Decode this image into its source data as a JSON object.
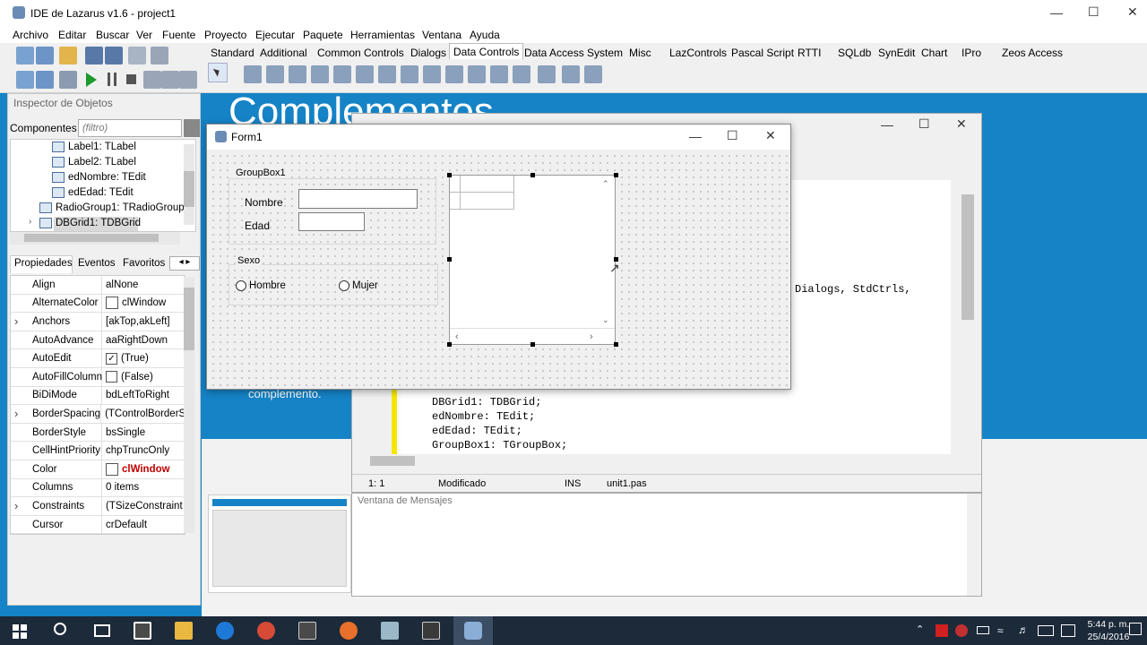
{
  "ide": {
    "title": "IDE de Lazarus v1.6 - project1",
    "menu": [
      "Archivo",
      "Editar",
      "Buscar",
      "Ver",
      "Fuente",
      "Proyecto",
      "Ejecutar",
      "Paquete",
      "Herramientas",
      "Ventana",
      "Ayuda"
    ],
    "palette_tabs": [
      "Standard",
      "Additional",
      "Common Controls",
      "Dialogs",
      "Data Controls",
      "Data Access",
      "System",
      "Misc",
      "LazControls",
      "Pascal Script",
      "RTTI",
      "SQLdb",
      "SynEdit",
      "Chart",
      "IPro",
      "Zeos Access"
    ],
    "active_tab": "Data Controls"
  },
  "desktop": {
    "title": "Complementos",
    "caption": "complemento."
  },
  "inspector": {
    "title": "Inspector de Objetos",
    "components_label": "Componentes",
    "filter_placeholder": "(filtro)",
    "tree": [
      "Label1: TLabel",
      "Label2: TLabel",
      "edNombre: TEdit",
      "edEdad: TEdit",
      "RadioGroup1: TRadioGroup",
      "DBGrid1: TDBGrid"
    ],
    "tabs": [
      "Propiedades",
      "Eventos",
      "Favoritos"
    ],
    "props": [
      {
        "name": "Align",
        "value": "alNone",
        "expand": false,
        "kind": "text"
      },
      {
        "name": "AlternateColor",
        "value": "clWindow",
        "expand": false,
        "kind": "color"
      },
      {
        "name": "Anchors",
        "value": "[akTop,akLeft]",
        "expand": true,
        "kind": "text"
      },
      {
        "name": "AutoAdvance",
        "value": "aaRightDown",
        "expand": false,
        "kind": "text"
      },
      {
        "name": "AutoEdit",
        "value": "(True)",
        "expand": false,
        "kind": "check-on"
      },
      {
        "name": "AutoFillColumn",
        "value": "(False)",
        "expand": false,
        "kind": "check-off"
      },
      {
        "name": "BiDiMode",
        "value": "bdLeftToRight",
        "expand": false,
        "kind": "text"
      },
      {
        "name": "BorderSpacing",
        "value": "(TControlBorderS",
        "expand": true,
        "kind": "text"
      },
      {
        "name": "BorderStyle",
        "value": "bsSingle",
        "expand": false,
        "kind": "text"
      },
      {
        "name": "CellHintPriority",
        "value": "chpTruncOnly",
        "expand": false,
        "kind": "text"
      },
      {
        "name": "Color",
        "value": "clWindow",
        "expand": false,
        "kind": "color-red"
      },
      {
        "name": "Columns",
        "value": "0 items",
        "expand": false,
        "kind": "text"
      },
      {
        "name": "Constraints",
        "value": "(TSizeConstraint",
        "expand": true,
        "kind": "text"
      },
      {
        "name": "Cursor",
        "value": "crDefault",
        "expand": false,
        "kind": "text"
      }
    ]
  },
  "form": {
    "title": "Form1",
    "groupbox1": "GroupBox1",
    "label_nombre": "Nombre",
    "label_edad": "Edad",
    "sexo": "Sexo",
    "radio_hombre": "Hombre",
    "radio_mujer": "Mujer"
  },
  "editor": {
    "code_line_uses": "Dialogs, StdCtrls,",
    "code": [
      "DBGrid1: TDBGrid;",
      "edNombre: TEdit;",
      "edEdad: TEdit;",
      "GroupBox1: TGroupBox;"
    ],
    "status_pos": "1:  1",
    "status_mod": "Modificado",
    "status_ins": "INS",
    "status_file": "unit1.pas"
  },
  "messages": {
    "title": "Ventana de Mensajes"
  },
  "clock": {
    "time": "5:44 p. m.",
    "date": "25/4/2016"
  },
  "colors": {
    "desktop": "#1583c6",
    "taskbar": "#1c2a3a",
    "selection": "#d9d9d9"
  }
}
